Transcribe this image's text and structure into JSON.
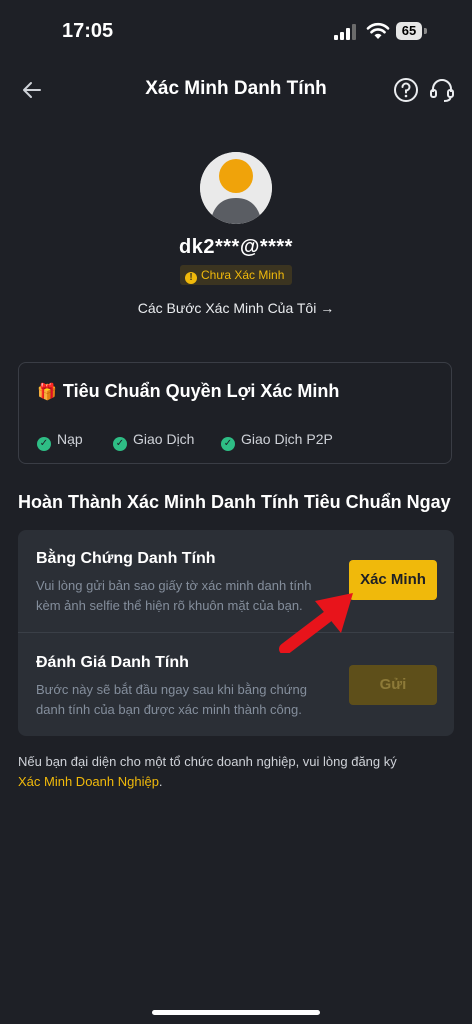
{
  "status_bar": {
    "time": "17:05",
    "battery": "65"
  },
  "header": {
    "title": "Xác Minh Danh Tính"
  },
  "profile": {
    "user": "dk2***@****",
    "status_badge": "Chưa Xác Minh",
    "steps_link": "Các Bước Xác Minh Của Tôi →"
  },
  "benefits": {
    "title": "Tiêu Chuẩn Quyền Lợi Xác Minh",
    "items": [
      "Nạp",
      "Giao Dịch",
      "Giao Dịch P2P"
    ]
  },
  "section": {
    "title": "Hoàn Thành Xác Minh Danh Tính Tiêu Chuẩn Ngay"
  },
  "steps": [
    {
      "title": "Bằng Chứng Danh Tính",
      "description": "Vui lòng gửi bản sao giấy tờ xác minh danh tính kèm ảnh selfie thể hiện rõ khuôn mặt của bạn.",
      "button": "Xác Minh"
    },
    {
      "title": "Đánh Giá Danh Tính",
      "description": "Bước này sẽ bắt đầu ngay sau khi bằng chứng danh tính của bạn được xác minh thành công.",
      "button": "Gửi"
    }
  ],
  "business": {
    "text": "Nếu bạn đại diện cho một tổ chức doanh nghiệp, vui lòng đăng ký",
    "link": "Xác Minh Doanh Nghiệp",
    "suffix": "."
  },
  "colors": {
    "accent": "#f0b90b",
    "background": "#1e2026",
    "card": "#2b2f36",
    "success": "#2ebd85",
    "annotation_arrow": "#e8141b"
  }
}
